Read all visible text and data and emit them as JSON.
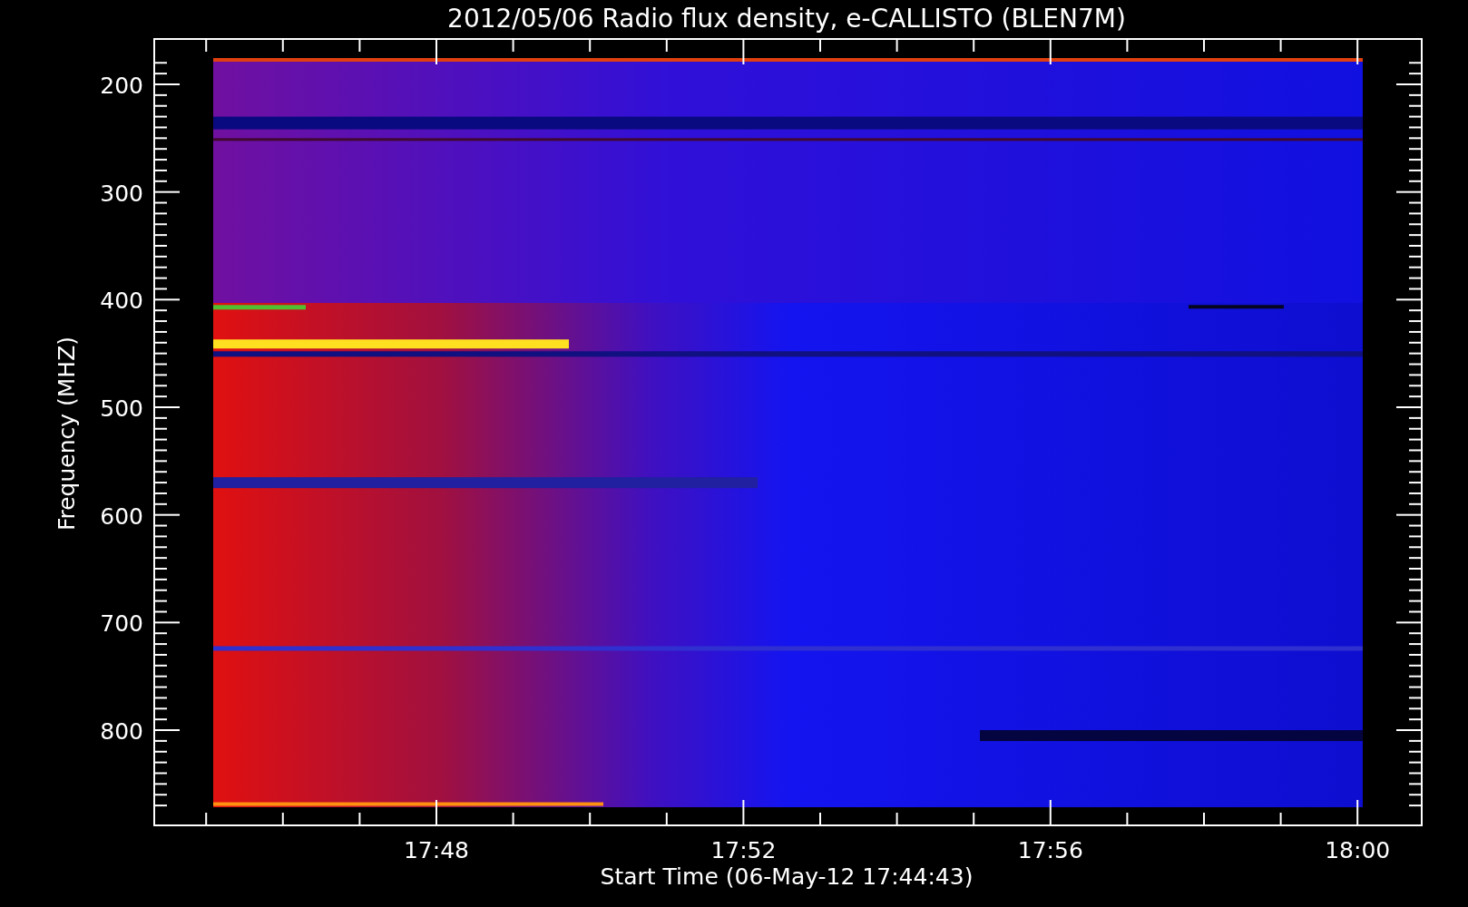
{
  "title": "2012/05/06  Radio flux density, e-CALLISTO (BLEN7M)",
  "y_axis": {
    "label": "Frequency (MHZ)",
    "ticks": [
      "200",
      "300",
      "400",
      "500",
      "600",
      "700",
      "800"
    ]
  },
  "x_axis": {
    "label": "Start Time (06-May-12 17:44:43)",
    "ticks": [
      "17:48",
      "17:52",
      "17:56",
      "18:00"
    ]
  }
}
